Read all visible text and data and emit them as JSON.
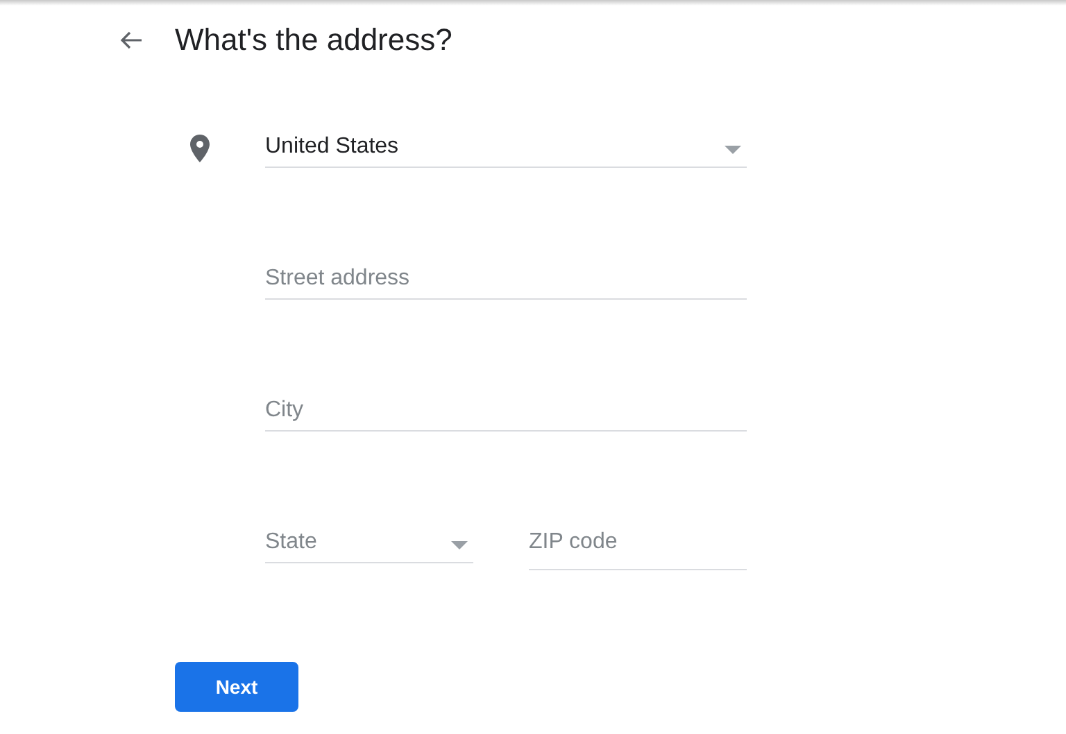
{
  "header": {
    "title": "What's the address?"
  },
  "rows": [
    {
      "fields": [
        {
          "kind": "select",
          "value": "United States"
        }
      ]
    },
    {
      "fields": [
        {
          "kind": "text",
          "placeholder": "Street address"
        }
      ]
    },
    {
      "fields": [
        {
          "kind": "text",
          "placeholder": "City"
        }
      ]
    },
    {
      "fields": [
        {
          "kind": "select",
          "placeholder": "State"
        },
        {
          "kind": "text",
          "placeholder": "ZIP code"
        }
      ]
    }
  ],
  "next_button": {
    "label": "Next"
  }
}
